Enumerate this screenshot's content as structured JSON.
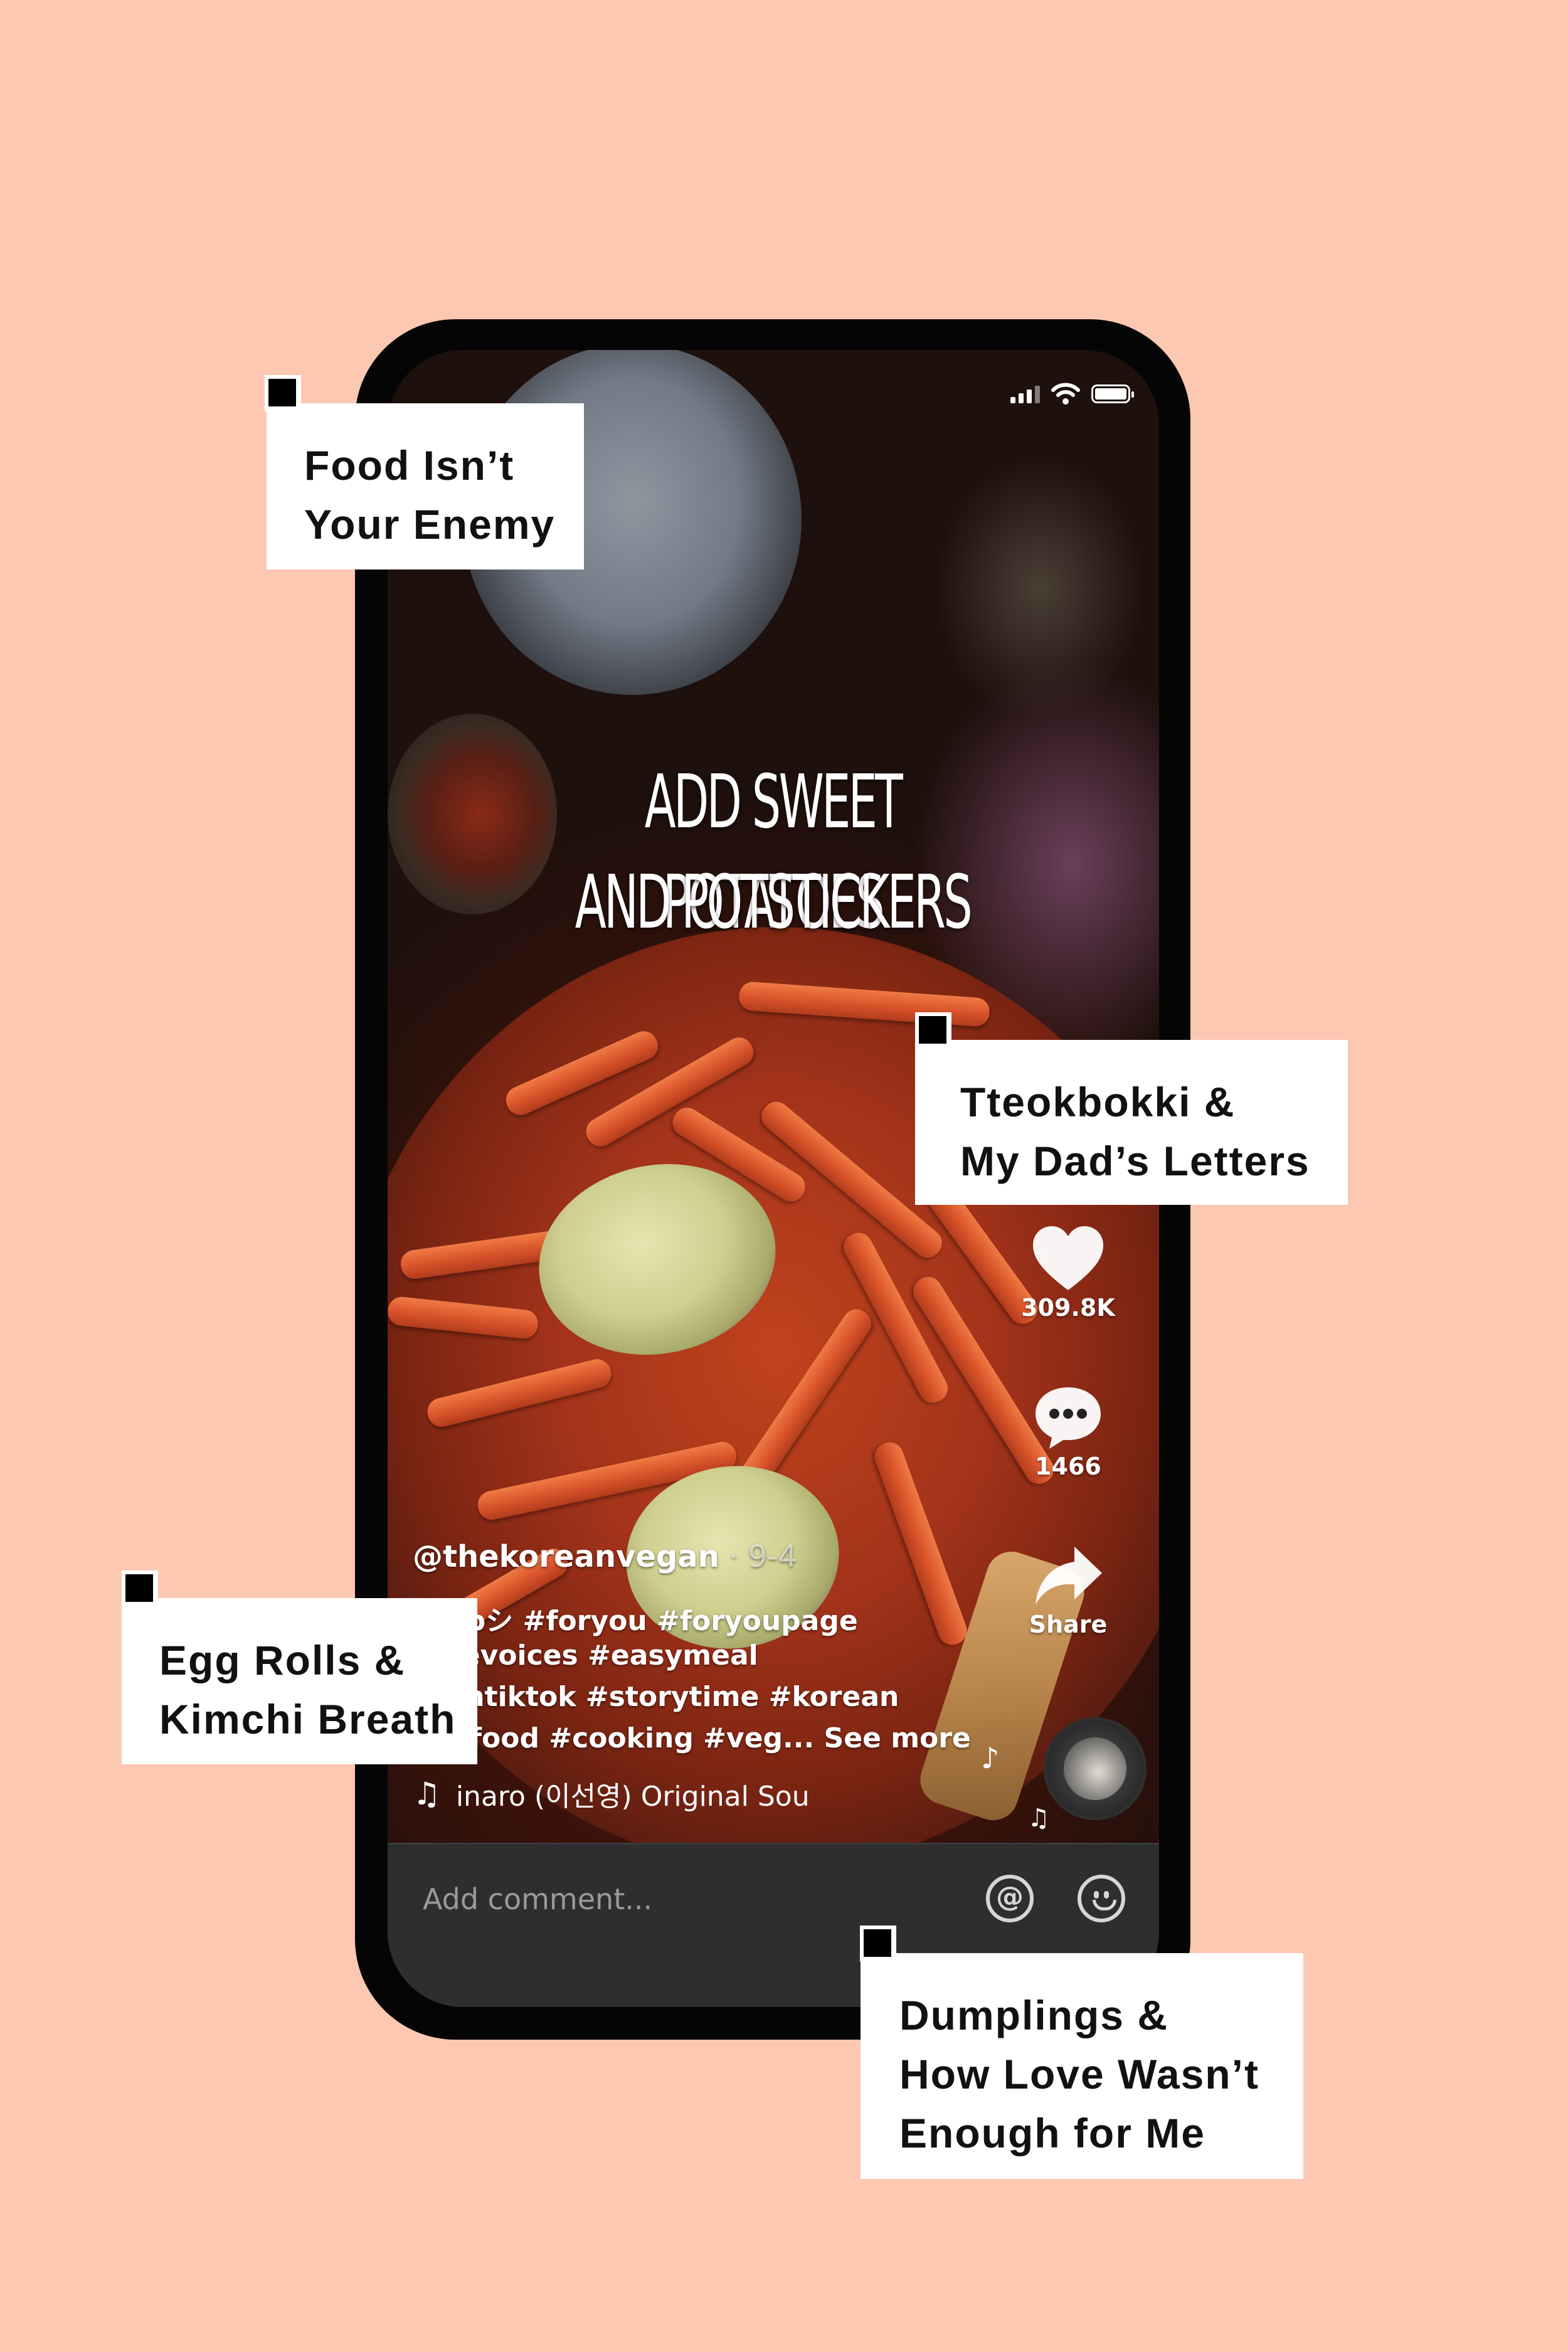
{
  "labels": [
    {
      "line1": "Food Isn’t",
      "line2": "Your Enemy",
      "line3": ""
    },
    {
      "line1": "Tteokbokki &",
      "line2": "My Dad’s Letters",
      "line3": ""
    },
    {
      "line1": "Egg Rolls &",
      "line2": "Kimchi Breath",
      "line3": ""
    },
    {
      "line1": "Dumplings &",
      "line2": "How Love Wasn’t",
      "line3": "Enough for Me"
    }
  ],
  "video": {
    "overlay_line1": "ADD SWEET POTATOES",
    "overlay_line2": "AND POTSTICKERS"
  },
  "actions": {
    "likes": "309.8K",
    "comments": "1466",
    "share_label": "Share"
  },
  "caption": {
    "username": "@thekoreanvegan",
    "date": " · 9-4",
    "line1": "#fypシ #foryou #foryoupage",
    "line2": "ersevoices #easymeal",
    "line3": "rnontiktok #storytime #korean",
    "line4": "eanfood #cooking #veg...",
    "see_more": "See more",
    "sound": "inaro (이선영) Original Sour"
  },
  "comment_bar": {
    "placeholder": "Add comment..."
  },
  "colors": {
    "background": "#fdc8b2",
    "phone_frame": "#050505",
    "comment_bar": "#2e2e2e"
  },
  "icons": [
    "signal-icon",
    "wifi-icon",
    "battery-icon",
    "heart-icon",
    "comment-icon",
    "share-icon",
    "music-note-icon",
    "at-icon",
    "emoji-icon",
    "sound-disc"
  ]
}
